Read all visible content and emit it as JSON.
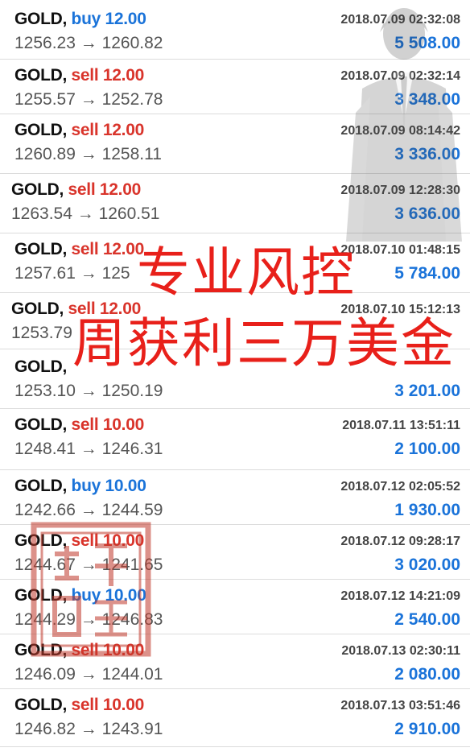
{
  "trades": [
    {
      "symbol": "GOLD,",
      "side": "buy 12.00",
      "dir": "buy",
      "prices": "1256.23 → 1260.82",
      "time": "2018.07.09 02:32:08",
      "profit": "5 508.00"
    },
    {
      "symbol": "GOLD,",
      "side": "sell 12.00",
      "dir": "sell",
      "prices": "1255.57 → 1252.78",
      "time": "2018.07.09 02:32:14",
      "profit": "3 348.00"
    },
    {
      "symbol": "GOLD,",
      "side": "sell 12.00",
      "dir": "sell",
      "prices": "1260.89 → 1258.11",
      "time": "2018.07.09 08:14:42",
      "profit": "3 336.00"
    },
    {
      "symbol": "GOLD,",
      "side": "sell 12.00",
      "dir": "sell",
      "prices": "1263.54 → 1260.51",
      "time": "2018.07.09 12:28:30",
      "profit": "3 636.00"
    },
    {
      "symbol": "GOLD,",
      "side": "sell 12.00",
      "dir": "sell",
      "prices": "1257.61 → 125",
      "time": "2018.07.10 01:48:15",
      "profit": "5 784.00"
    },
    {
      "symbol": "GOLD,",
      "side": "sell 12.00",
      "dir": "sell",
      "prices": "1253.79",
      "time": "2018.07.10 15:12:13",
      "profit": ""
    },
    {
      "symbol": "GOLD,",
      "side": "",
      "dir": "sell",
      "prices": "1253.10 → 1250.19",
      "time": "",
      "profit": "3 201.00"
    },
    {
      "symbol": "GOLD,",
      "side": "sell 10.00",
      "dir": "sell",
      "prices": "1248.41 → 1246.31",
      "time": "2018.07.11 13:51:11",
      "profit": "2 100.00"
    },
    {
      "symbol": "GOLD,",
      "side": "buy 10.00",
      "dir": "buy",
      "prices": "1242.66 → 1244.59",
      "time": "2018.07.12 02:05:52",
      "profit": "1 930.00"
    },
    {
      "symbol": "GOLD,",
      "side": "sell 10.00",
      "dir": "sell",
      "prices": "1244.67 → 1241.65",
      "time": "2018.07.12 09:28:17",
      "profit": "3 020.00"
    },
    {
      "symbol": "GOLD,",
      "side": "buy 10.00",
      "dir": "buy",
      "prices": "1244.29 → 1246.83",
      "time": "2018.07.12 14:21:09",
      "profit": "2 540.00"
    },
    {
      "symbol": "GOLD,",
      "side": "sell 10.00",
      "dir": "sell",
      "prices": "1246.09 → 1244.01",
      "time": "2018.07.13 02:30:11",
      "profit": "2 080.00"
    },
    {
      "symbol": "GOLD,",
      "side": "sell 10.00",
      "dir": "sell",
      "prices": "1246.82 → 1243.91",
      "time": "2018.07.13 03:51:46",
      "profit": "2 910.00"
    }
  ],
  "overlay": {
    "line1": "专业风控",
    "line2": "周获利三万美金"
  },
  "colors": {
    "buy": "#1a73d9",
    "sell": "#d9342b",
    "profit": "#1a73d9",
    "overlay": "#e8201a",
    "seal": "#c0392b"
  },
  "icons": [
    "figure-watermark",
    "seal-stamp"
  ]
}
